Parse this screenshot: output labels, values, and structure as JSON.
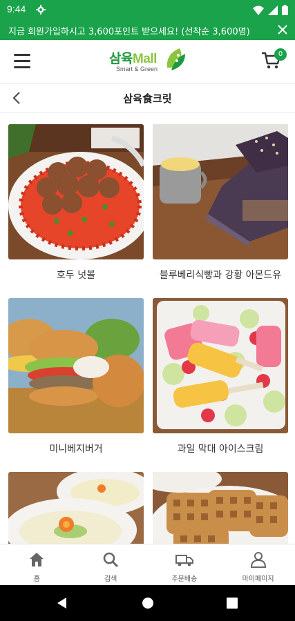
{
  "status_bar": {
    "time": "9:44"
  },
  "promo": {
    "text": "지금 회원가입하시고 3,600포인트 받으세요! (선착순 3,600명)"
  },
  "header": {
    "logo_main": "삼육",
    "logo_mall": "Mall",
    "logo_sub": "Smart & Green",
    "cart_count": "0"
  },
  "page": {
    "title": "삼육食크릿"
  },
  "recipes": [
    {
      "title": "호두 넛볼",
      "image": "meatballs-photo"
    },
    {
      "title": "블루베리식빵과 강황 아몬드유",
      "image": "blueberry-bread-photo"
    },
    {
      "title": "미니베지버거",
      "image": "veggie-burger-photo"
    },
    {
      "title": "과일 막대 아이스크림",
      "image": "fruit-popsicle-photo"
    },
    {
      "title": "",
      "image": "soup-bowls-photo"
    },
    {
      "title": "",
      "image": "waffles-photo"
    }
  ],
  "bottom_nav": [
    {
      "label": "홈",
      "icon": "home-icon"
    },
    {
      "label": "검색",
      "icon": "search-icon"
    },
    {
      "label": "주문배송",
      "icon": "truck-icon"
    },
    {
      "label": "마이페이지",
      "icon": "user-icon"
    }
  ],
  "colors": {
    "brand_green": "#1aa34a",
    "logo_light_green": "#8bc53f"
  }
}
